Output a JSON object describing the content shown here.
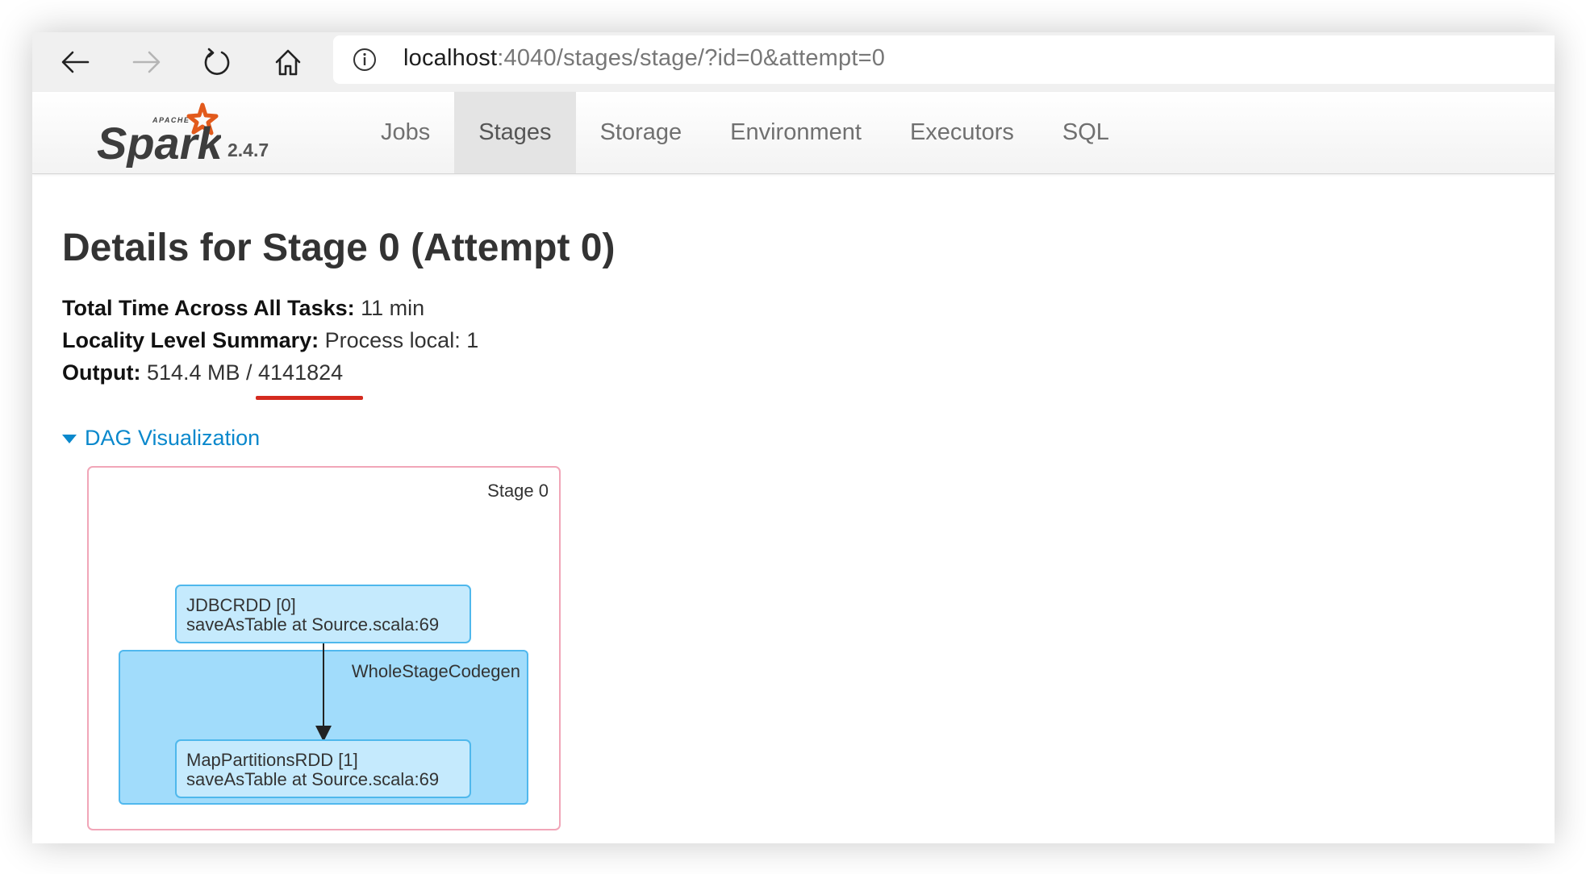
{
  "browser": {
    "url_host": "localhost",
    "url_path": ":4040/stages/stage/?id=0&attempt=0"
  },
  "navbar": {
    "brand_top": "APACHE",
    "brand_name": "Spark",
    "version": "2.4.7",
    "tabs": [
      {
        "label": "Jobs",
        "active": false
      },
      {
        "label": "Stages",
        "active": true
      },
      {
        "label": "Storage",
        "active": false
      },
      {
        "label": "Environment",
        "active": false
      },
      {
        "label": "Executors",
        "active": false
      },
      {
        "label": "SQL",
        "active": false
      }
    ]
  },
  "page": {
    "title": "Details for Stage 0 (Attempt 0)",
    "summary": [
      {
        "label": "Total Time Across All Tasks:",
        "value": " 11 min"
      },
      {
        "label": "Locality Level Summary:",
        "value": " Process local: 1"
      },
      {
        "label": "Output:",
        "value": " 514.4 MB / 4141824"
      }
    ],
    "dag_toggle": "DAG Visualization"
  },
  "dag": {
    "stage_label": "Stage 0",
    "cluster_label": "WholeStageCodegen",
    "nodes": [
      {
        "line1": "JDBCRDD [0]",
        "line2": "saveAsTable at Source.scala:69"
      },
      {
        "line1": "MapPartitionsRDD [1]",
        "line2": "saveAsTable at Source.scala:69"
      }
    ]
  },
  "colors": {
    "link": "#0a88cc",
    "highlight_underline": "#d42a1f",
    "stage_border": "#f1a6b8",
    "cluster_fill": "#a1dcfb",
    "node_fill": "#c5eafd",
    "node_border": "#4fb8ec",
    "spark_orange": "#e25a1c"
  }
}
